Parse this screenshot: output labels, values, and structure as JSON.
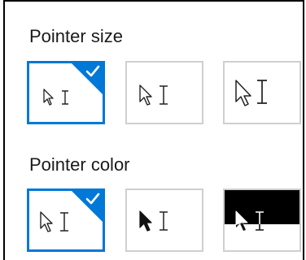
{
  "pointer_size": {
    "title": "Pointer size",
    "options": [
      {
        "name": "small",
        "selected": true
      },
      {
        "name": "medium",
        "selected": false
      },
      {
        "name": "large",
        "selected": false
      }
    ]
  },
  "pointer_color": {
    "title": "Pointer color",
    "options": [
      {
        "name": "white",
        "selected": true
      },
      {
        "name": "black",
        "selected": false
      },
      {
        "name": "inverted",
        "selected": false
      }
    ]
  },
  "colors": {
    "accent": "#0078d7",
    "tile_border": "#cfcfcf",
    "text": "#1a1a1a"
  },
  "icons": {
    "arrow": "arrow-pointer-icon",
    "text_select": "text-select-icon",
    "check": "checkmark-icon"
  }
}
